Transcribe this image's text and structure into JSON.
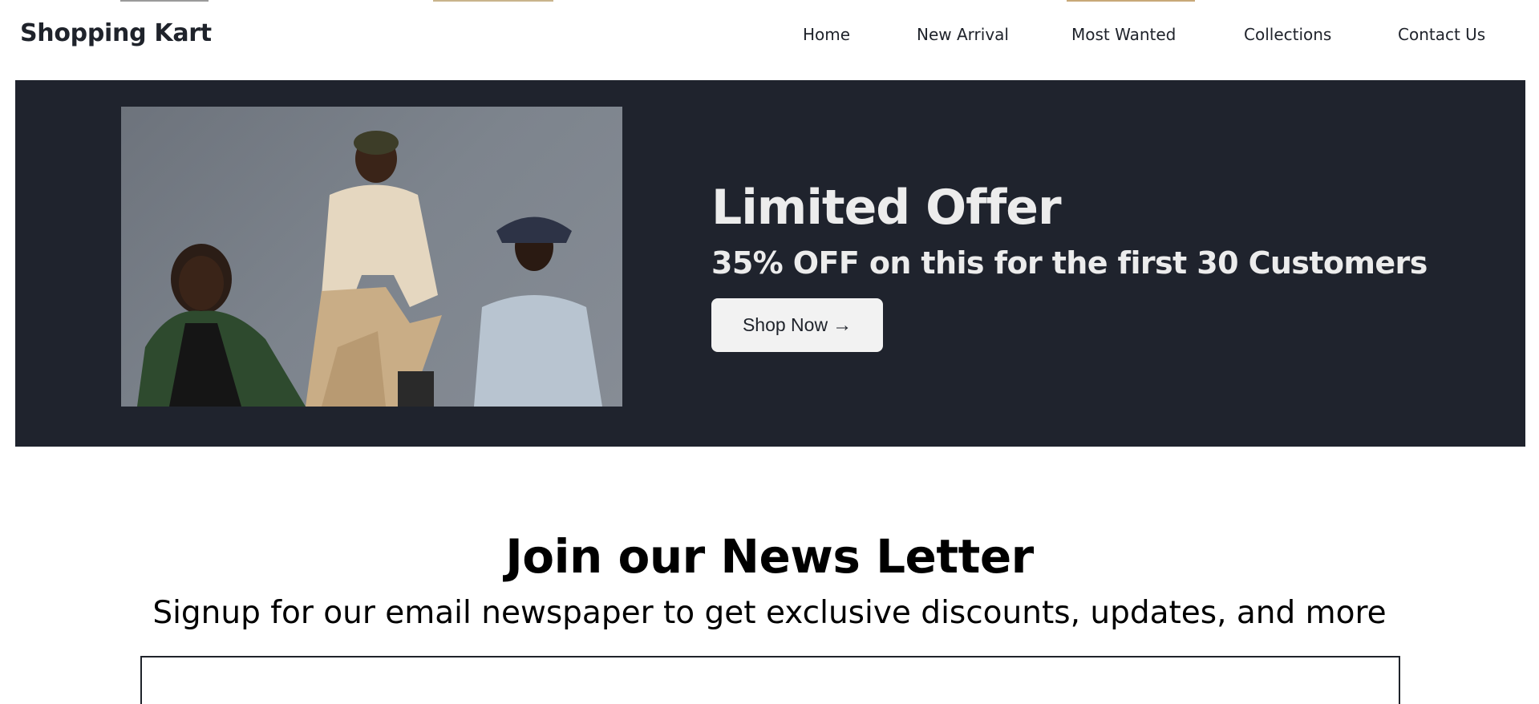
{
  "brand": "Shopping Kart",
  "nav": {
    "items": [
      {
        "label": "Home"
      },
      {
        "label": "New Arrival"
      },
      {
        "label": "Most Wanted"
      },
      {
        "label": "Collections"
      },
      {
        "label": "Contact Us"
      }
    ]
  },
  "hero": {
    "title": "Limited Offer",
    "subtitle": "35% OFF on this for the first 30 Customers",
    "button_label": "Shop Now",
    "button_icon": "arrow-right-icon",
    "background_color": "#1f232d"
  },
  "newsletter": {
    "title": "Join our News Letter",
    "subtitle": "Signup for our email newspaper to get exclusive discounts, updates, and more"
  }
}
